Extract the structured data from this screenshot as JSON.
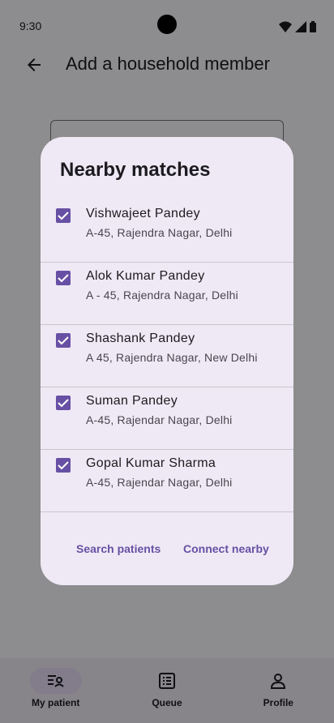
{
  "status_bar": {
    "time": "9:30"
  },
  "app_bar": {
    "title": "Add a household member"
  },
  "dialog": {
    "title": "Nearby matches",
    "matches": [
      {
        "name": "Vishwajeet Pandey",
        "address": "A-45, Rajendra Nagar, Delhi",
        "checked": true
      },
      {
        "name": "Alok Kumar Pandey",
        "address": "A - 45, Rajendra Nagar, Delhi",
        "checked": true
      },
      {
        "name": "Shashank Pandey",
        "address": "A 45, Rajendra Nagar, New Delhi",
        "checked": true
      },
      {
        "name": "Suman Pandey",
        "address": "A-45, Rajendar Nagar, Delhi",
        "checked": true
      },
      {
        "name": "Gopal Kumar Sharma",
        "address": "A-45, Rajendar Nagar, Delhi",
        "checked": true
      }
    ],
    "actions": {
      "search_label": "Search patients",
      "connect_label": "Connect nearby"
    }
  },
  "bottom_nav": {
    "items": [
      {
        "label": "My patient",
        "icon": "patient-list-icon",
        "active": true
      },
      {
        "label": "Queue",
        "icon": "queue-icon",
        "active": false
      },
      {
        "label": "Profile",
        "icon": "person-icon",
        "active": false
      }
    ]
  },
  "colors": {
    "accent": "#6750a4",
    "dialog_bg": "#efe9f5",
    "nav_active_pill": "#e8def8"
  }
}
